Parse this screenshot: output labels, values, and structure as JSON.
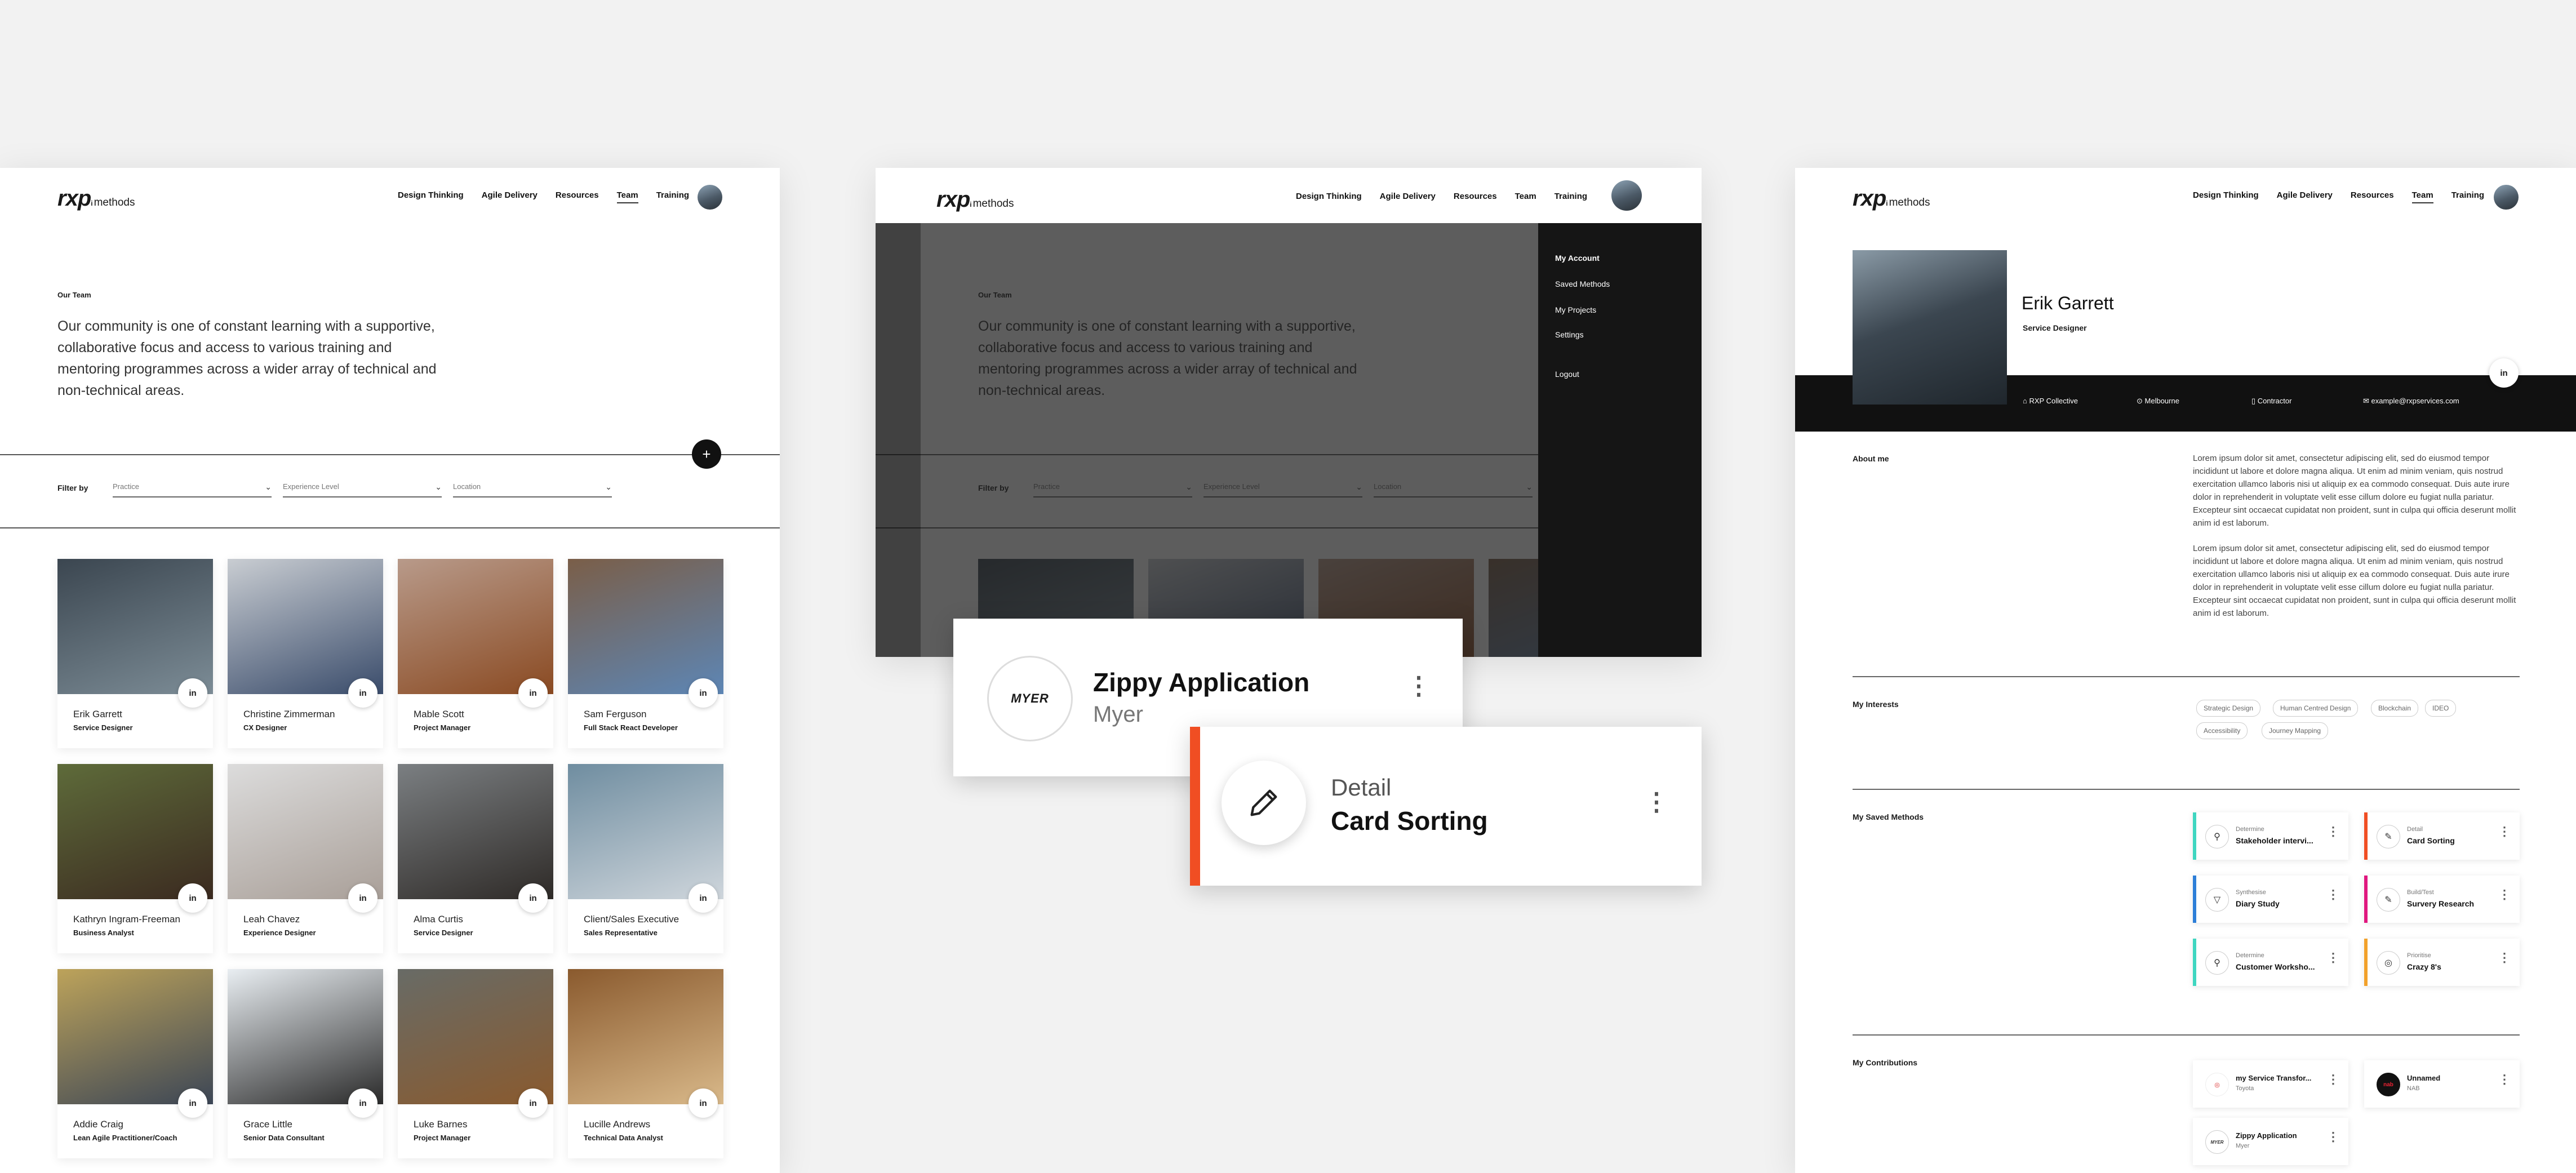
{
  "brand": {
    "name": "rxp",
    "sup": "i",
    "product": "methods"
  },
  "nav": [
    "Design Thinking",
    "Agile Delivery",
    "Resources",
    "Team",
    "Training"
  ],
  "team_page": {
    "label": "Our Team",
    "intro_lines": [
      "Our community is one of constant learning with a supportive,",
      "collaborative focus and access to various training and",
      "mentoring programmes across a wider array of technical and",
      "non-technical areas."
    ],
    "add_icon": "+",
    "filter_label": "Filter by",
    "filters": [
      "Practice",
      "Experience Level",
      "Location"
    ],
    "linkedin": "in",
    "members": [
      {
        "name": "Erik Garrett",
        "role": "Service Designer",
        "photo": [
          "#3b4650",
          "#7c8c96"
        ]
      },
      {
        "name": "Christine Zimmerman",
        "role": "CX Designer",
        "photo": [
          "#c9cdd2",
          "#3a4c6b"
        ]
      },
      {
        "name": "Mable Scott",
        "role": "Project Manager",
        "photo": [
          "#b89a8a",
          "#8a4a22"
        ]
      },
      {
        "name": "Sam Ferguson",
        "role": "Full Stack React Developer",
        "photo": [
          "#7a5e48",
          "#5d86b5"
        ]
      },
      {
        "name": "Kathryn Ingram-Freeman",
        "role": "Business Analyst",
        "photo": [
          "#5e6b3a",
          "#3b2a20"
        ]
      },
      {
        "name": "Leah Chavez",
        "role": "Experience Designer",
        "photo": [
          "#dcdcdc",
          "#a99f98"
        ]
      },
      {
        "name": "Alma Curtis",
        "role": "Service Designer",
        "photo": [
          "#7b7f82",
          "#2e2a27"
        ]
      },
      {
        "name": "Client/Sales Executive",
        "role": "Sales Representative",
        "photo": [
          "#6f8da0",
          "#cfd6dc"
        ]
      },
      {
        "name": "Addie Craig",
        "role": "Lean Agile Practitioner/Coach",
        "photo": [
          "#bda35a",
          "#3c4656"
        ]
      },
      {
        "name": "Grace Little",
        "role": "Senior Data Consultant",
        "photo": [
          "#e9eef2",
          "#2a2a2a"
        ]
      },
      {
        "name": "Luke Barnes",
        "role": "Project Manager",
        "photo": [
          "#686b66",
          "#8a5a2e"
        ]
      },
      {
        "name": "Lucille Andrews",
        "role": "Technical Data Analyst",
        "photo": [
          "#8a5a2e",
          "#d9b98a"
        ]
      }
    ]
  },
  "account_menu": {
    "items": [
      "My Account",
      "Saved Methods",
      "My Projects",
      "Settings",
      "Logout"
    ]
  },
  "zoom_cards": {
    "app": {
      "logo": "MYER",
      "title": "Zippy Application",
      "subtitle": "Myer"
    },
    "method": {
      "category": "Detail",
      "title": "Card Sorting",
      "accent": "#f04e23"
    }
  },
  "profile": {
    "name": "Erik Garrett",
    "role": "Service Designer",
    "linkedin": "in",
    "info": [
      {
        "icon": "building-icon",
        "text": "RXP Collective"
      },
      {
        "icon": "location-pin-icon",
        "text": "Melbourne"
      },
      {
        "icon": "document-icon",
        "text": "Contractor"
      },
      {
        "icon": "mail-icon",
        "text": "example@rxpservices.com"
      }
    ],
    "about_title": "About me",
    "about": [
      "Lorem ipsum dolor sit amet, consectetur adipiscing elit, sed do eiusmod tempor incididunt ut labore et dolore magna aliqua. Ut enim ad minim veniam, quis nostrud exercitation ullamco laboris nisi ut aliquip ex ea commodo consequat. Duis aute irure dolor in reprehenderit in voluptate velit esse cillum dolore eu fugiat nulla pariatur. Excepteur sint occaecat cupidatat non proident, sunt in culpa qui officia deserunt mollit anim id est laborum.",
      "Lorem ipsum dolor sit amet, consectetur adipiscing elit, sed do eiusmod tempor incididunt ut labore et dolore magna aliqua. Ut enim ad minim veniam, quis nostrud exercitation ullamco laboris nisi ut aliquip ex ea commodo consequat. Duis aute irure dolor in reprehenderit in voluptate velit esse cillum dolore eu fugiat nulla pariatur. Excepteur sint occaecat cupidatat non proident, sunt in culpa qui officia deserunt mollit anim id est laborum."
    ],
    "interests_title": "My Interests",
    "interests": [
      "Strategic Design",
      "Human Centred Design",
      "Blockchain",
      "IDEO",
      "Accessibility",
      "Journey Mapping"
    ],
    "saved_title": "My Saved Methods",
    "saved": [
      {
        "category": "Determine",
        "title": "Stakeholder intervi...",
        "accent": "#3fd6c0",
        "icon": "⚲"
      },
      {
        "category": "Detail",
        "title": "Card Sorting",
        "accent": "#f04e23",
        "icon": "✎"
      },
      {
        "category": "Synthesise",
        "title": "Diary Study",
        "accent": "#2d7fd8",
        "icon": "▽"
      },
      {
        "category": "Build/Test",
        "title": "Survery Research",
        "accent": "#e0177f",
        "icon": "✎"
      },
      {
        "category": "Determine",
        "title": "Customer Worksho...",
        "accent": "#3fd6c0",
        "icon": "⚲"
      },
      {
        "category": "Prioritise",
        "title": "Crazy 8's",
        "accent": "#f2a12b",
        "icon": "◎"
      }
    ],
    "contrib_title": "My Contributions",
    "contributions": [
      {
        "title": "my Service Transfor...",
        "sub": "Toyota"
      },
      {
        "title": "Unnamed",
        "sub": "NAB"
      },
      {
        "title": "Zippy Application",
        "sub": "Myer"
      }
    ]
  }
}
